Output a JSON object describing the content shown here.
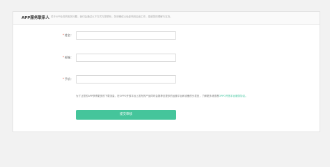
{
  "header": {
    "title": "APP服务联系人",
    "notice": "关于APP业务的相关问题，我们会通过以下方式与您联系，务请确保以免影响到后续工作。感谢您的理解与支持。"
  },
  "form": {
    "fields": [
      {
        "label": "姓名：",
        "value": "",
        "placeholder": ""
      },
      {
        "label": "邮箱：",
        "value": "",
        "placeholder": ""
      },
      {
        "label": "手机：",
        "value": "",
        "placeholder": ""
      }
    ],
    "required_mark": "*",
    "note": "为了让您的APP获得更多的下载流量，在OPPO开放平台上发布的产品同时会推荐至更多的运营平台和设备的分发处，了解更多请查看",
    "note_link": "OPPO开放平台服务协议。",
    "submit_label": "提交审核"
  },
  "colors": {
    "accent": "#45c59b",
    "required": "#e5533b"
  }
}
